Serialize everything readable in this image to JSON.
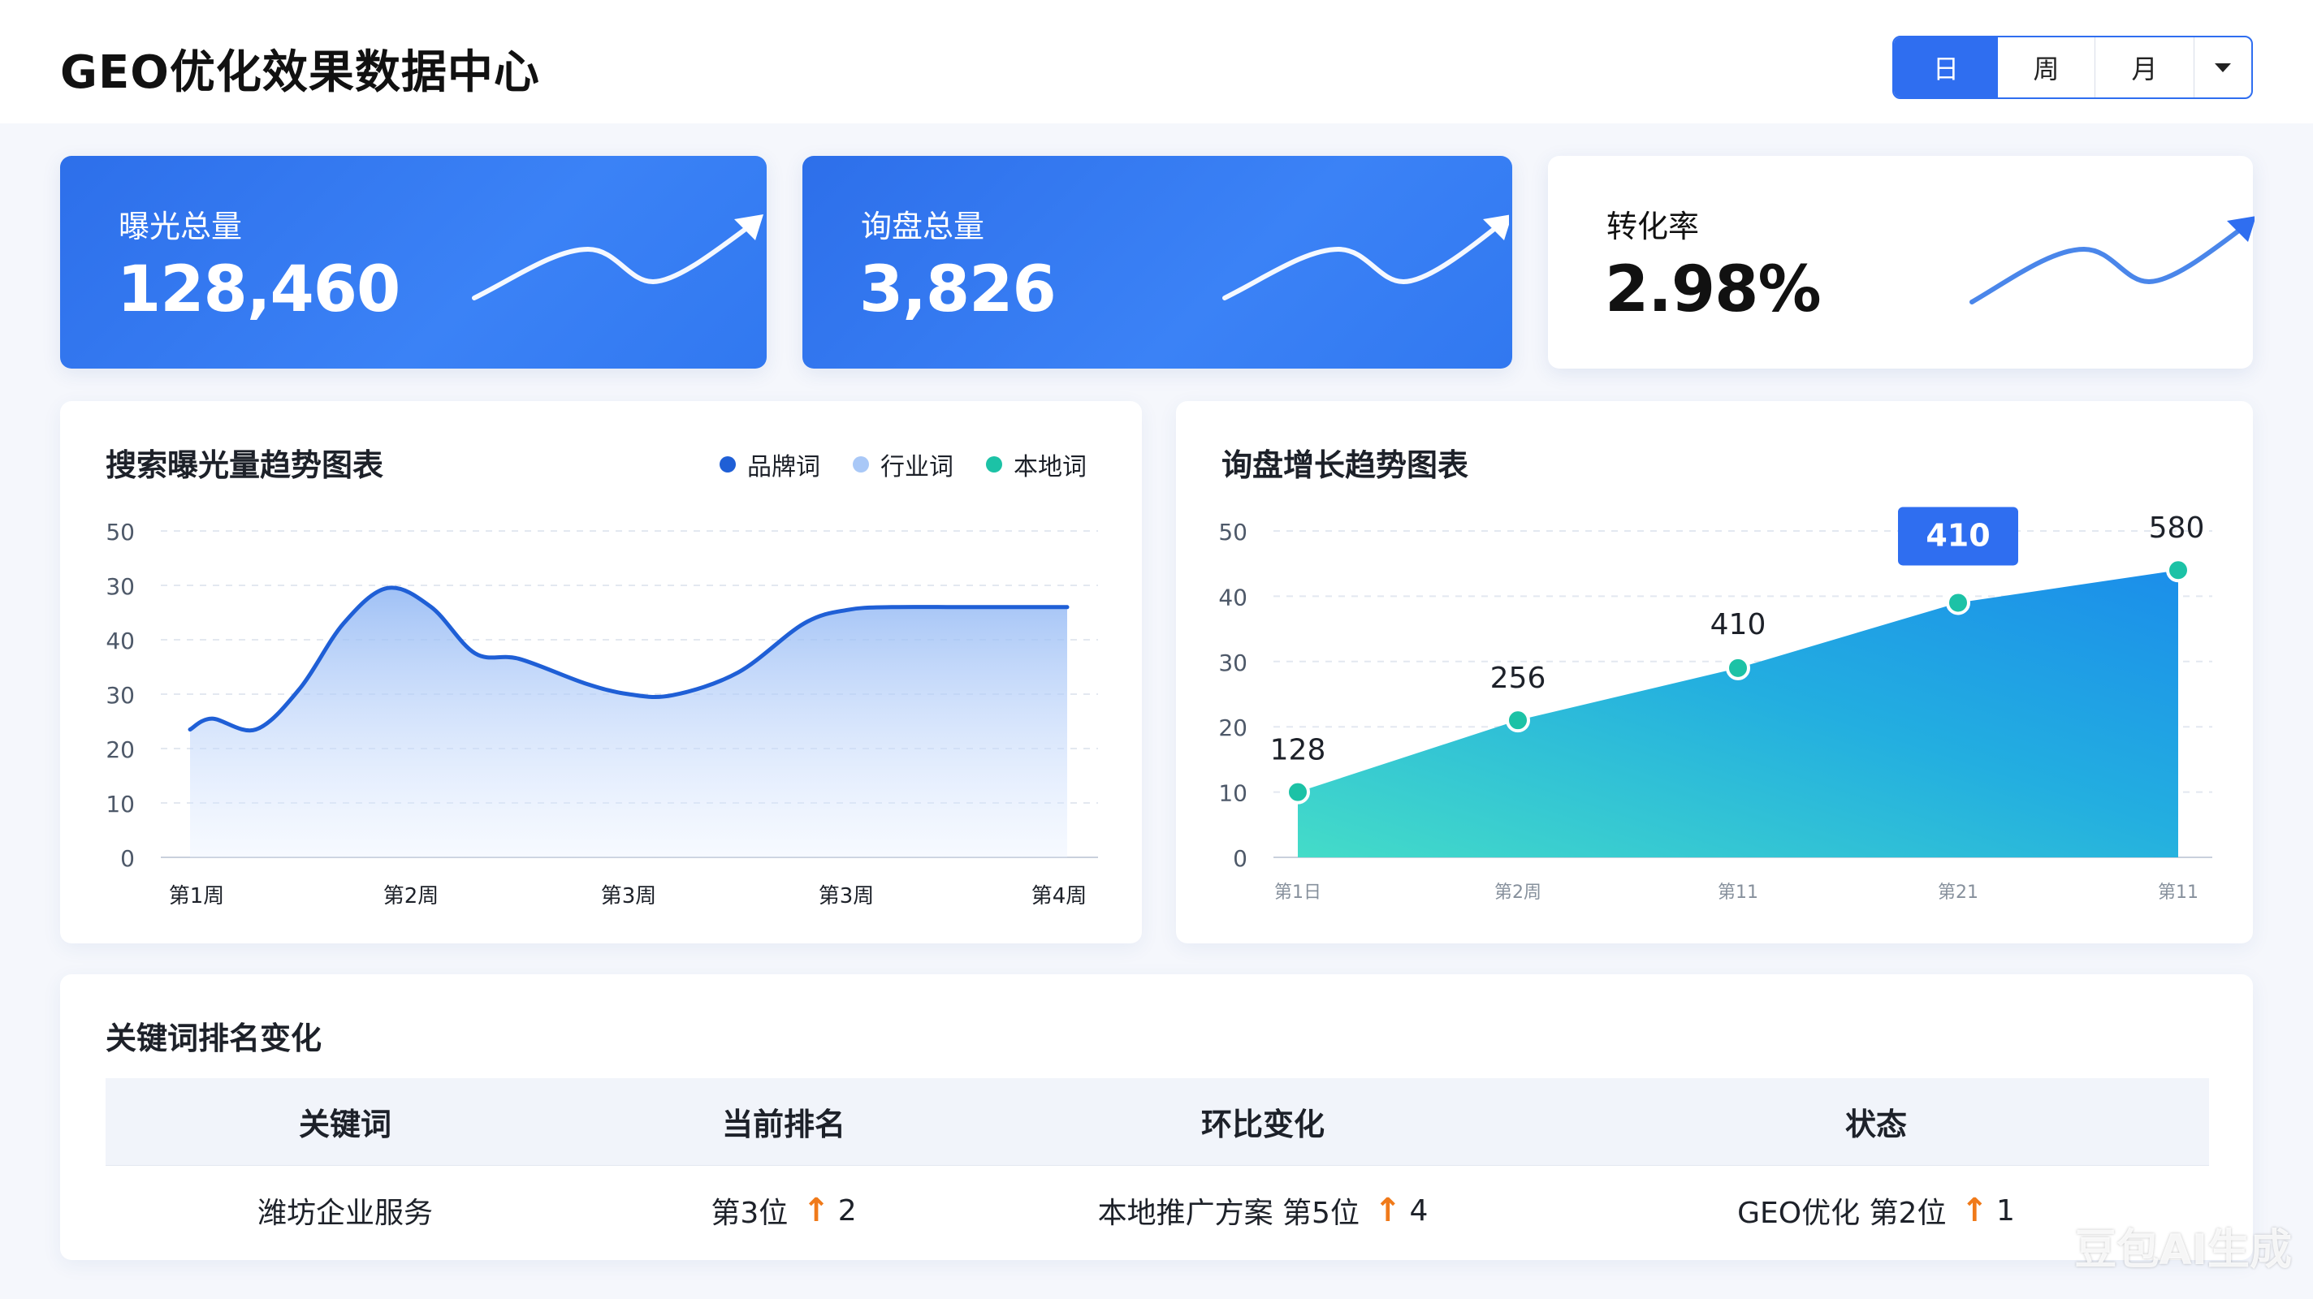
{
  "header": {
    "title": "GEO优化效果数据中心",
    "range_options": [
      "日",
      "周",
      "月"
    ],
    "selected_range": "日"
  },
  "kpis": [
    {
      "label": "曝光总量",
      "value": "128,460",
      "style": "blue"
    },
    {
      "label": "询盘总量",
      "value": "3,826",
      "style": "blue"
    },
    {
      "label": "转化率",
      "value": "2.98%",
      "style": "white"
    }
  ],
  "colors": {
    "primary": "#2f6ef0",
    "brand_series": "#1f5fd6",
    "industry_series": "#a9c8f7",
    "local_series": "#1cc2a6",
    "rank_up": "#f07a1a"
  },
  "chart_data": [
    {
      "type": "area",
      "title": "搜索曝光量趋势图表",
      "y_tick_labels": [
        "0",
        "10",
        "20",
        "30",
        "40",
        "30",
        "50"
      ],
      "x_tick_labels": [
        "第1周",
        "第2周",
        "第3周",
        "第3周",
        "第4周"
      ],
      "legend": [
        "品牌词",
        "行业词",
        "本地词"
      ],
      "legend_position": "top-right",
      "grid": true,
      "ylim": [
        0,
        60
      ],
      "series": [
        {
          "name": "品牌词",
          "x": [
            0,
            0.1,
            0.3,
            0.5,
            0.7,
            0.9,
            1.1,
            1.3,
            1.5,
            1.8,
            2.0,
            2.2,
            2.5,
            2.8,
            3.0,
            3.2,
            3.5,
            3.7,
            4.0
          ],
          "y": [
            23.5,
            25.5,
            23.5,
            31,
            43,
            49.5,
            46,
            37.5,
            36.5,
            32,
            30,
            29.8,
            34,
            43,
            45.5,
            46,
            46,
            46,
            46
          ]
        }
      ]
    },
    {
      "type": "area",
      "title": "询盘增长趋势图表",
      "y_tick_labels": [
        "0",
        "10",
        "20",
        "30",
        "40",
        "50"
      ],
      "x_tick_labels": [
        "第1日",
        "第2周",
        "第11",
        "第21",
        "第11"
      ],
      "grid": true,
      "ylim": [
        0,
        50
      ],
      "series": [
        {
          "x": [
            0,
            1,
            2,
            3,
            4
          ],
          "y": [
            10,
            21,
            29,
            39,
            44
          ],
          "labels": [
            "128",
            "256",
            "410",
            "410",
            "580"
          ],
          "highlight_index": 3
        }
      ]
    }
  ],
  "table": {
    "title": "关键词排名变化",
    "columns": [
      "关键词",
      "当前排名",
      "环比变化",
      "状态"
    ],
    "rows": [
      {
        "keyword": "潍坊企业服务",
        "rank": "第3位",
        "rank_change": "2",
        "compare": "本地推广方案 第5位",
        "compare_change": "4",
        "status": "GEO优化 第2位",
        "status_change": "1"
      }
    ]
  },
  "watermark": "豆包AI生成"
}
